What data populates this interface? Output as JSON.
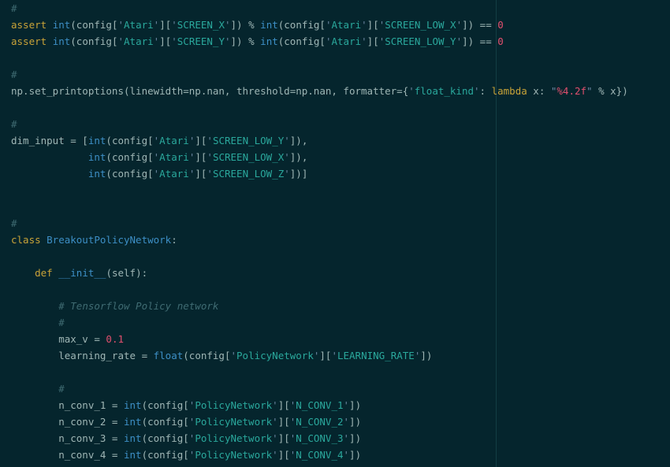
{
  "editor": {
    "colors": {
      "background": "#05252d",
      "plain": "#9fb6b5",
      "comment": "#3f6b72",
      "keyword": "#c9a338",
      "builtin": "#3d8fc6",
      "string": "#2aa89c",
      "number": "#e14f6e"
    },
    "lines": [
      {
        "y": 0,
        "tokens": [
          {
            "t": "#",
            "c": "comment"
          }
        ]
      },
      {
        "y": 1,
        "tokens": [
          {
            "t": "assert ",
            "c": "keyword"
          },
          {
            "t": "int",
            "c": "builtin"
          },
          {
            "t": "(config[",
            "c": "plain"
          },
          {
            "t": "'",
            "c": "string"
          },
          {
            "t": "Atari",
            "c": "string-content"
          },
          {
            "t": "'",
            "c": "string"
          },
          {
            "t": "][",
            "c": "plain"
          },
          {
            "t": "'",
            "c": "string"
          },
          {
            "t": "SCREEN_X",
            "c": "string-content"
          },
          {
            "t": "'",
            "c": "string"
          },
          {
            "t": "]) % ",
            "c": "plain"
          },
          {
            "t": "int",
            "c": "builtin"
          },
          {
            "t": "(config[",
            "c": "plain"
          },
          {
            "t": "'",
            "c": "string"
          },
          {
            "t": "Atari",
            "c": "string-content"
          },
          {
            "t": "'",
            "c": "string"
          },
          {
            "t": "][",
            "c": "plain"
          },
          {
            "t": "'",
            "c": "string"
          },
          {
            "t": "SCREEN_LOW_X",
            "c": "string-content"
          },
          {
            "t": "'",
            "c": "string"
          },
          {
            "t": "]) == ",
            "c": "plain"
          },
          {
            "t": "0",
            "c": "number"
          }
        ]
      },
      {
        "y": 2,
        "tokens": [
          {
            "t": "assert ",
            "c": "keyword"
          },
          {
            "t": "int",
            "c": "builtin"
          },
          {
            "t": "(config[",
            "c": "plain"
          },
          {
            "t": "'",
            "c": "string"
          },
          {
            "t": "Atari",
            "c": "string-content"
          },
          {
            "t": "'",
            "c": "string"
          },
          {
            "t": "][",
            "c": "plain"
          },
          {
            "t": "'",
            "c": "string"
          },
          {
            "t": "SCREEN_Y",
            "c": "string-content"
          },
          {
            "t": "'",
            "c": "string"
          },
          {
            "t": "]) % ",
            "c": "plain"
          },
          {
            "t": "int",
            "c": "builtin"
          },
          {
            "t": "(config[",
            "c": "plain"
          },
          {
            "t": "'",
            "c": "string"
          },
          {
            "t": "Atari",
            "c": "string-content"
          },
          {
            "t": "'",
            "c": "string"
          },
          {
            "t": "][",
            "c": "plain"
          },
          {
            "t": "'",
            "c": "string"
          },
          {
            "t": "SCREEN_LOW_Y",
            "c": "string-content"
          },
          {
            "t": "'",
            "c": "string"
          },
          {
            "t": "]) == ",
            "c": "plain"
          },
          {
            "t": "0",
            "c": "number"
          }
        ]
      },
      {
        "y": 4,
        "tokens": [
          {
            "t": "#",
            "c": "comment"
          }
        ]
      },
      {
        "y": 5,
        "tokens": [
          {
            "t": "np.set_printoptions(linewidth=np.nan, threshold=np.nan, formatter={",
            "c": "plain"
          },
          {
            "t": "'",
            "c": "string"
          },
          {
            "t": "float_kind",
            "c": "string-content"
          },
          {
            "t": "'",
            "c": "string"
          },
          {
            "t": ": ",
            "c": "plain"
          },
          {
            "t": "lambda",
            "c": "keyword"
          },
          {
            "t": " x: ",
            "c": "plain"
          },
          {
            "t": "\"",
            "c": "string"
          },
          {
            "t": "%4.2f",
            "c": "strlit"
          },
          {
            "t": "\"",
            "c": "string"
          },
          {
            "t": " % x})",
            "c": "plain"
          }
        ]
      },
      {
        "y": 7,
        "tokens": [
          {
            "t": "#",
            "c": "comment"
          }
        ]
      },
      {
        "y": 8,
        "tokens": [
          {
            "t": "dim_input = [",
            "c": "plain"
          },
          {
            "t": "int",
            "c": "builtin"
          },
          {
            "t": "(config[",
            "c": "plain"
          },
          {
            "t": "'",
            "c": "string"
          },
          {
            "t": "Atari",
            "c": "string-content"
          },
          {
            "t": "'",
            "c": "string"
          },
          {
            "t": "][",
            "c": "plain"
          },
          {
            "t": "'",
            "c": "string"
          },
          {
            "t": "SCREEN_LOW_Y",
            "c": "string-content"
          },
          {
            "t": "'",
            "c": "string"
          },
          {
            "t": "]),",
            "c": "plain"
          }
        ]
      },
      {
        "y": 9,
        "tokens": [
          {
            "t": "             ",
            "c": "plain"
          },
          {
            "t": "int",
            "c": "builtin"
          },
          {
            "t": "(config[",
            "c": "plain"
          },
          {
            "t": "'",
            "c": "string"
          },
          {
            "t": "Atari",
            "c": "string-content"
          },
          {
            "t": "'",
            "c": "string"
          },
          {
            "t": "][",
            "c": "plain"
          },
          {
            "t": "'",
            "c": "string"
          },
          {
            "t": "SCREEN_LOW_X",
            "c": "string-content"
          },
          {
            "t": "'",
            "c": "string"
          },
          {
            "t": "]),",
            "c": "plain"
          }
        ]
      },
      {
        "y": 10,
        "tokens": [
          {
            "t": "             ",
            "c": "plain"
          },
          {
            "t": "int",
            "c": "builtin"
          },
          {
            "t": "(config[",
            "c": "plain"
          },
          {
            "t": "'",
            "c": "string"
          },
          {
            "t": "Atari",
            "c": "string-content"
          },
          {
            "t": "'",
            "c": "string"
          },
          {
            "t": "][",
            "c": "plain"
          },
          {
            "t": "'",
            "c": "string"
          },
          {
            "t": "SCREEN_LOW_Z",
            "c": "string-content"
          },
          {
            "t": "'",
            "c": "string"
          },
          {
            "t": "])]",
            "c": "plain"
          }
        ]
      },
      {
        "y": 13,
        "tokens": [
          {
            "t": "#",
            "c": "comment"
          }
        ]
      },
      {
        "y": 14,
        "tokens": [
          {
            "t": "class ",
            "c": "keyword"
          },
          {
            "t": "BreakoutPolicyNetwork",
            "c": "class"
          },
          {
            "t": ":",
            "c": "plain"
          }
        ]
      },
      {
        "y": 16,
        "tokens": [
          {
            "t": "    ",
            "c": "plain"
          },
          {
            "t": "def ",
            "c": "keyword"
          },
          {
            "t": "__init__",
            "c": "class"
          },
          {
            "t": "(self):",
            "c": "plain"
          }
        ]
      },
      {
        "y": 18,
        "tokens": [
          {
            "t": "        ",
            "c": "plain"
          },
          {
            "t": "# Tensorflow Policy network",
            "c": "comment-italic"
          }
        ]
      },
      {
        "y": 19,
        "tokens": [
          {
            "t": "        ",
            "c": "plain"
          },
          {
            "t": "#",
            "c": "comment"
          }
        ]
      },
      {
        "y": 20,
        "tokens": [
          {
            "t": "        max_v = ",
            "c": "plain"
          },
          {
            "t": "0.1",
            "c": "number"
          }
        ]
      },
      {
        "y": 21,
        "tokens": [
          {
            "t": "        learning_rate = ",
            "c": "plain"
          },
          {
            "t": "float",
            "c": "builtin"
          },
          {
            "t": "(config[",
            "c": "plain"
          },
          {
            "t": "'",
            "c": "string"
          },
          {
            "t": "PolicyNetwork",
            "c": "string-content"
          },
          {
            "t": "'",
            "c": "string"
          },
          {
            "t": "][",
            "c": "plain"
          },
          {
            "t": "'",
            "c": "string"
          },
          {
            "t": "LEARNING_RATE",
            "c": "string-content"
          },
          {
            "t": "'",
            "c": "string"
          },
          {
            "t": "])",
            "c": "plain"
          }
        ]
      },
      {
        "y": 23,
        "tokens": [
          {
            "t": "        ",
            "c": "plain"
          },
          {
            "t": "#",
            "c": "comment"
          }
        ]
      },
      {
        "y": 24,
        "tokens": [
          {
            "t": "        n_conv_1 = ",
            "c": "plain"
          },
          {
            "t": "int",
            "c": "builtin"
          },
          {
            "t": "(config[",
            "c": "plain"
          },
          {
            "t": "'",
            "c": "string"
          },
          {
            "t": "PolicyNetwork",
            "c": "string-content"
          },
          {
            "t": "'",
            "c": "string"
          },
          {
            "t": "][",
            "c": "plain"
          },
          {
            "t": "'",
            "c": "string"
          },
          {
            "t": "N_CONV_1",
            "c": "string-content"
          },
          {
            "t": "'",
            "c": "string"
          },
          {
            "t": "])",
            "c": "plain"
          }
        ]
      },
      {
        "y": 25,
        "tokens": [
          {
            "t": "        n_conv_2 = ",
            "c": "plain"
          },
          {
            "t": "int",
            "c": "builtin"
          },
          {
            "t": "(config[",
            "c": "plain"
          },
          {
            "t": "'",
            "c": "string"
          },
          {
            "t": "PolicyNetwork",
            "c": "string-content"
          },
          {
            "t": "'",
            "c": "string"
          },
          {
            "t": "][",
            "c": "plain"
          },
          {
            "t": "'",
            "c": "string"
          },
          {
            "t": "N_CONV_2",
            "c": "string-content"
          },
          {
            "t": "'",
            "c": "string"
          },
          {
            "t": "])",
            "c": "plain"
          }
        ]
      },
      {
        "y": 26,
        "tokens": [
          {
            "t": "        n_conv_3 = ",
            "c": "plain"
          },
          {
            "t": "int",
            "c": "builtin"
          },
          {
            "t": "(config[",
            "c": "plain"
          },
          {
            "t": "'",
            "c": "string"
          },
          {
            "t": "PolicyNetwork",
            "c": "string-content"
          },
          {
            "t": "'",
            "c": "string"
          },
          {
            "t": "][",
            "c": "plain"
          },
          {
            "t": "'",
            "c": "string"
          },
          {
            "t": "N_CONV_3",
            "c": "string-content"
          },
          {
            "t": "'",
            "c": "string"
          },
          {
            "t": "])",
            "c": "plain"
          }
        ]
      },
      {
        "y": 27,
        "tokens": [
          {
            "t": "        n_conv_4 = ",
            "c": "plain"
          },
          {
            "t": "int",
            "c": "builtin"
          },
          {
            "t": "(config[",
            "c": "plain"
          },
          {
            "t": "'",
            "c": "string"
          },
          {
            "t": "PolicyNetwork",
            "c": "string-content"
          },
          {
            "t": "'",
            "c": "string"
          },
          {
            "t": "][",
            "c": "plain"
          },
          {
            "t": "'",
            "c": "string"
          },
          {
            "t": "N_CONV_4",
            "c": "string-content"
          },
          {
            "t": "'",
            "c": "string"
          },
          {
            "t": "])",
            "c": "plain"
          }
        ]
      }
    ]
  }
}
